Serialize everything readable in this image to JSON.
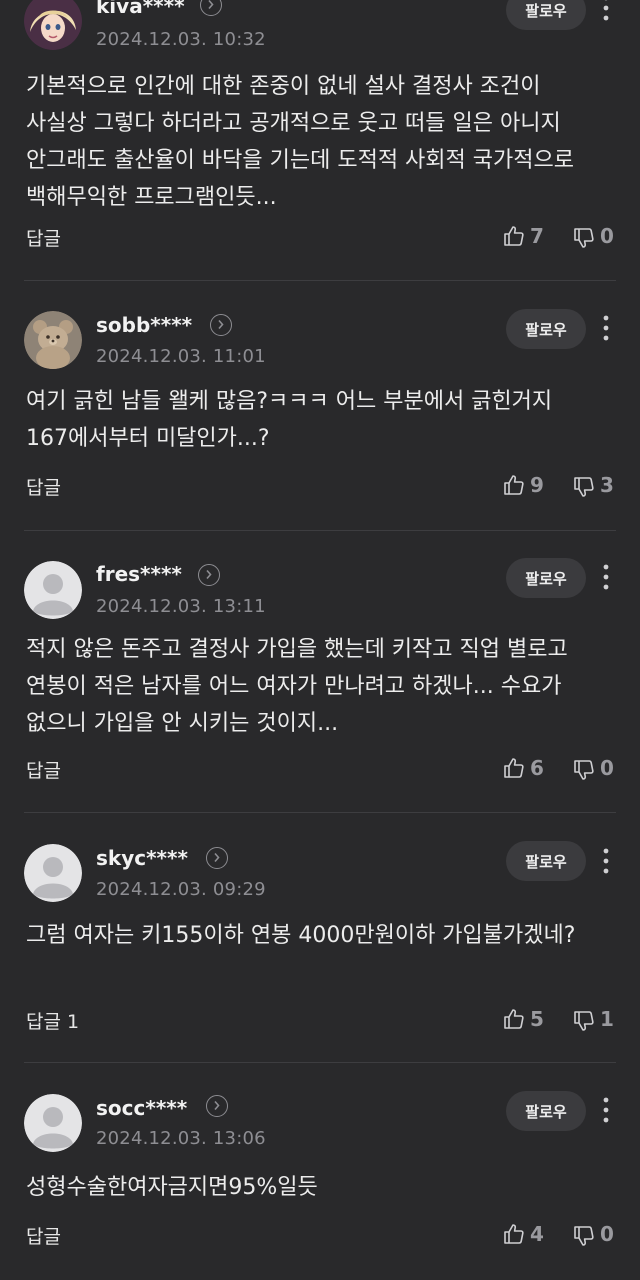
{
  "colors": {
    "background": "#29292b",
    "divider": "#3d3d40",
    "follow_button_bg": "#3b3b3e",
    "secondary_text": "#8e8e93"
  },
  "comments": [
    {
      "username": "kiva****",
      "date": "2024.12.03. 10:32",
      "avatar": "anime-character-avatar",
      "text": "기본적으로 인간에 대한 존중이 없네 설사 결정사 조건이 사실상 그렇다 하더라고 공개적으로 웃고 떠들 일은 아니지 안그래도 출산율이 바닥을 기는데 도적적 사회적 국가적으로 백해무익한 프로그램인듯...",
      "reply_label": "답글",
      "likes": "7",
      "dislikes": "0",
      "follow_label": "팔로우"
    },
    {
      "username": "sobb****",
      "date": "2024.12.03. 11:01",
      "avatar": "teddy-bear-avatar",
      "text": "여기 긁힌 남들 왤케 많음?ㅋㅋㅋ 어느 부분에서 긁힌거지 167에서부터 미달인가...?",
      "reply_label": "답글",
      "likes": "9",
      "dislikes": "3",
      "follow_label": "팔로우"
    },
    {
      "username": "fres****",
      "date": "2024.12.03. 13:11",
      "avatar": "default-user-avatar",
      "text": "적지 않은 돈주고 결정사 가입을 했는데 키작고 직업 별로고 연봉이 적은 남자를 어느 여자가 만나려고 하겠나... 수요가 없으니 가입을 안 시키는 것이지...",
      "reply_label": "답글",
      "likes": "6",
      "dislikes": "0",
      "follow_label": "팔로우"
    },
    {
      "username": "skyc****",
      "date": "2024.12.03. 09:29",
      "avatar": "default-user-avatar",
      "text": "그럼 여자는 키155이하 연봉 4000만원이하 가입불가겠네?",
      "reply_label": "답글 1",
      "likes": "5",
      "dislikes": "1",
      "follow_label": "팔로우"
    },
    {
      "username": "socc****",
      "date": "2024.12.03. 13:06",
      "avatar": "default-user-avatar",
      "text": "성형수술한여자금지면95%일듯",
      "reply_label": "답글",
      "likes": "4",
      "dislikes": "0",
      "follow_label": "팔로우"
    }
  ]
}
